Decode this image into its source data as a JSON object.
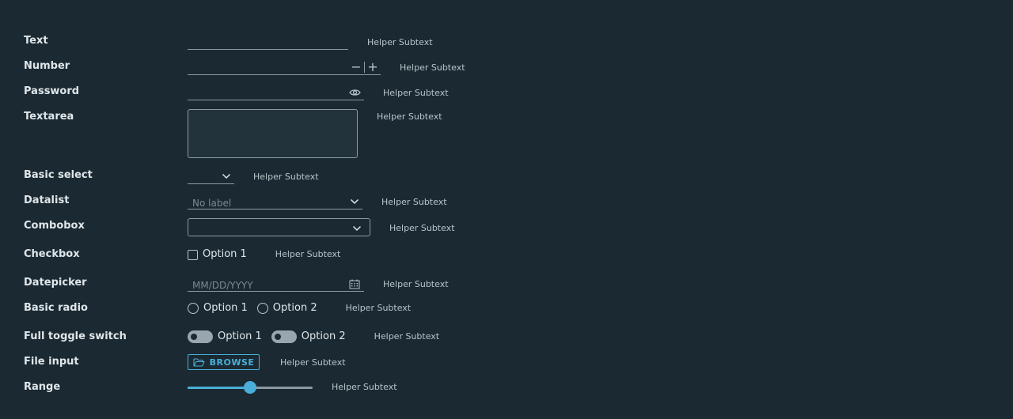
{
  "form": {
    "helper_text": "Helper Subtext",
    "text": {
      "label": "Text",
      "value": "",
      "helper": "Helper Subtext"
    },
    "number": {
      "label": "Number",
      "value": "",
      "helper": "Helper Subtext",
      "decrement_glyph": "−",
      "increment_glyph": "+"
    },
    "password": {
      "label": "Password",
      "value": "",
      "helper": "Helper Subtext",
      "icon": "eye-icon"
    },
    "textarea": {
      "label": "Textarea",
      "value": "",
      "helper": "Helper Subtext"
    },
    "basic_select": {
      "label": "Basic select",
      "selected": "",
      "helper": "Helper Subtext",
      "icon": "chevron-down-icon"
    },
    "datalist": {
      "label": "Datalist",
      "placeholder": "No label",
      "helper": "Helper Subtext",
      "icon": "chevron-down-icon"
    },
    "combobox": {
      "label": "Combobox",
      "value": "",
      "helper": "Helper Subtext",
      "icon": "chevron-down-icon"
    },
    "checkbox": {
      "label": "Checkbox",
      "option": "Option 1",
      "checked": false,
      "helper": "Helper Subtext"
    },
    "datepicker": {
      "label": "Datepicker",
      "placeholder": "MM/DD/YYYY",
      "helper": "Helper Subtext",
      "icon": "calendar-icon"
    },
    "basic_radio": {
      "label": "Basic radio",
      "options": [
        "Option 1",
        "Option 2"
      ],
      "helper": "Helper Subtext"
    },
    "toggle_switch": {
      "label": "Full toggle switch",
      "options": [
        "Option 1",
        "Option 2"
      ],
      "helper": "Helper Subtext"
    },
    "file_input": {
      "label": "File input",
      "button_label": "BROWSE",
      "icon": "folder-open-icon",
      "helper": "Helper Subtext"
    },
    "range": {
      "label": "Range",
      "value_percent": 50,
      "helper": "Helper Subtext"
    }
  },
  "colors": {
    "background": "#1b2a32",
    "accent": "#49afd9",
    "border": "#8c9aa2",
    "label_text": "#dfe6ea",
    "helper_text": "#b9c4ca"
  }
}
